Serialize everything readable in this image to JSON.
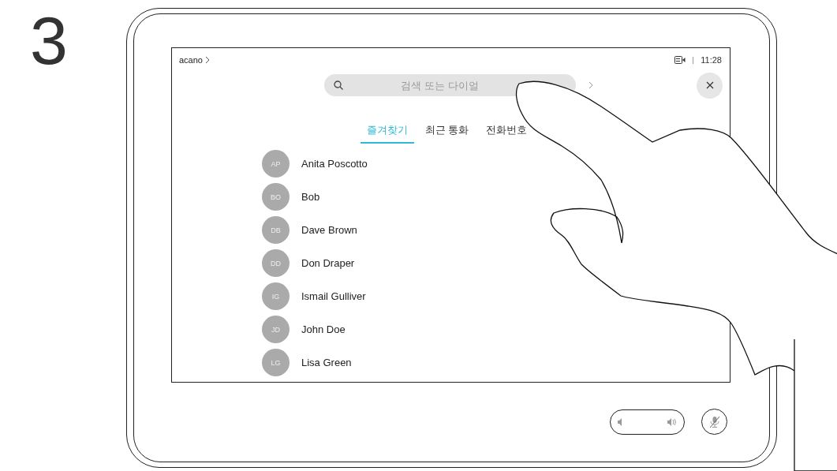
{
  "step": "3",
  "screen": {
    "breadcrumb": "acano",
    "time": "11:28",
    "search": {
      "placeholder": "검색 또는 다이얼"
    },
    "tabs": [
      {
        "label": "즐겨찾기",
        "selected": true
      },
      {
        "label": "최근 통화",
        "selected": false
      },
      {
        "label": "전화번호",
        "selected": false
      }
    ],
    "contacts": [
      {
        "initials": "AP",
        "name": "Anita Poscotto"
      },
      {
        "initials": "BO",
        "name": "Bob"
      },
      {
        "initials": "DB",
        "name": "Dave Brown"
      },
      {
        "initials": "DD",
        "name": "Don Draper"
      },
      {
        "initials": "IG",
        "name": "Ismail Gulliver"
      },
      {
        "initials": "JD",
        "name": "John Doe"
      },
      {
        "initials": "LG",
        "name": "Lisa Green"
      }
    ]
  }
}
